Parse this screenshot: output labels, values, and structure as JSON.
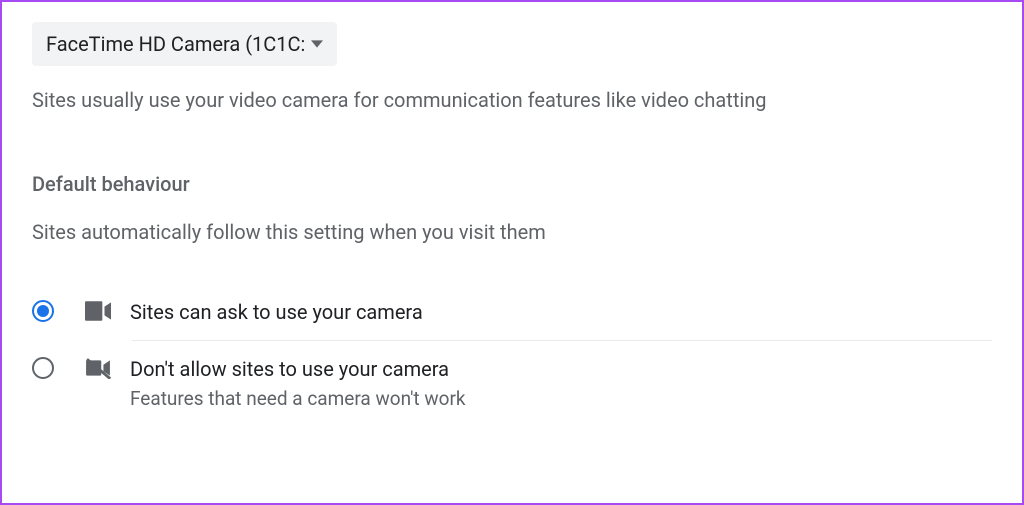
{
  "camera_select": {
    "selected_label": "FaceTime HD Camera (1C1C:"
  },
  "description": "Sites usually use your video camera for communication features like video chatting",
  "section": {
    "title": "Default behaviour",
    "subtitle": "Sites automatically follow this setting when you visit them"
  },
  "options": [
    {
      "title": "Sites can ask to use your camera",
      "subtitle": "",
      "checked": true
    },
    {
      "title": "Don't allow sites to use your camera",
      "subtitle": "Features that need a camera won't work",
      "checked": false
    }
  ]
}
